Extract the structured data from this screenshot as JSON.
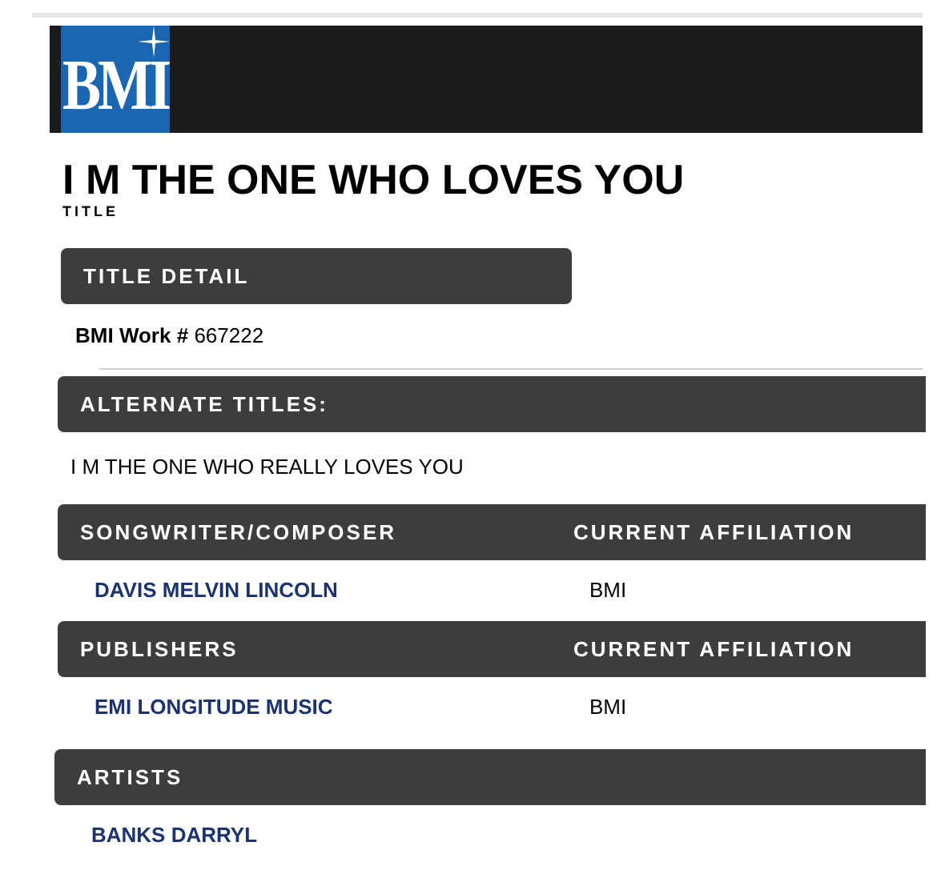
{
  "header": {
    "logo": "BMI"
  },
  "title": {
    "text": "I M THE ONE WHO LOVES YOU",
    "label": "TITLE"
  },
  "title_detail": {
    "heading": "TITLE DETAIL",
    "work_label": "BMI Work #",
    "work_number": "667222"
  },
  "alternate_titles": {
    "heading": "ALTERNATE TITLES:",
    "items": [
      "I M THE ONE WHO REALLY LOVES YOU"
    ]
  },
  "songwriters": {
    "heading": "SONGWRITER/COMPOSER",
    "affiliation_heading": "CURRENT AFFILIATION",
    "rows": [
      {
        "name": "DAVIS MELVIN LINCOLN",
        "affiliation": "BMI"
      }
    ]
  },
  "publishers": {
    "heading": "PUBLISHERS",
    "affiliation_heading": "CURRENT AFFILIATION",
    "rows": [
      {
        "name": "EMI LONGITUDE MUSIC",
        "affiliation": "BMI"
      }
    ]
  },
  "artists": {
    "heading": "ARTISTS",
    "items": [
      "BANKS DARRYL"
    ]
  }
}
